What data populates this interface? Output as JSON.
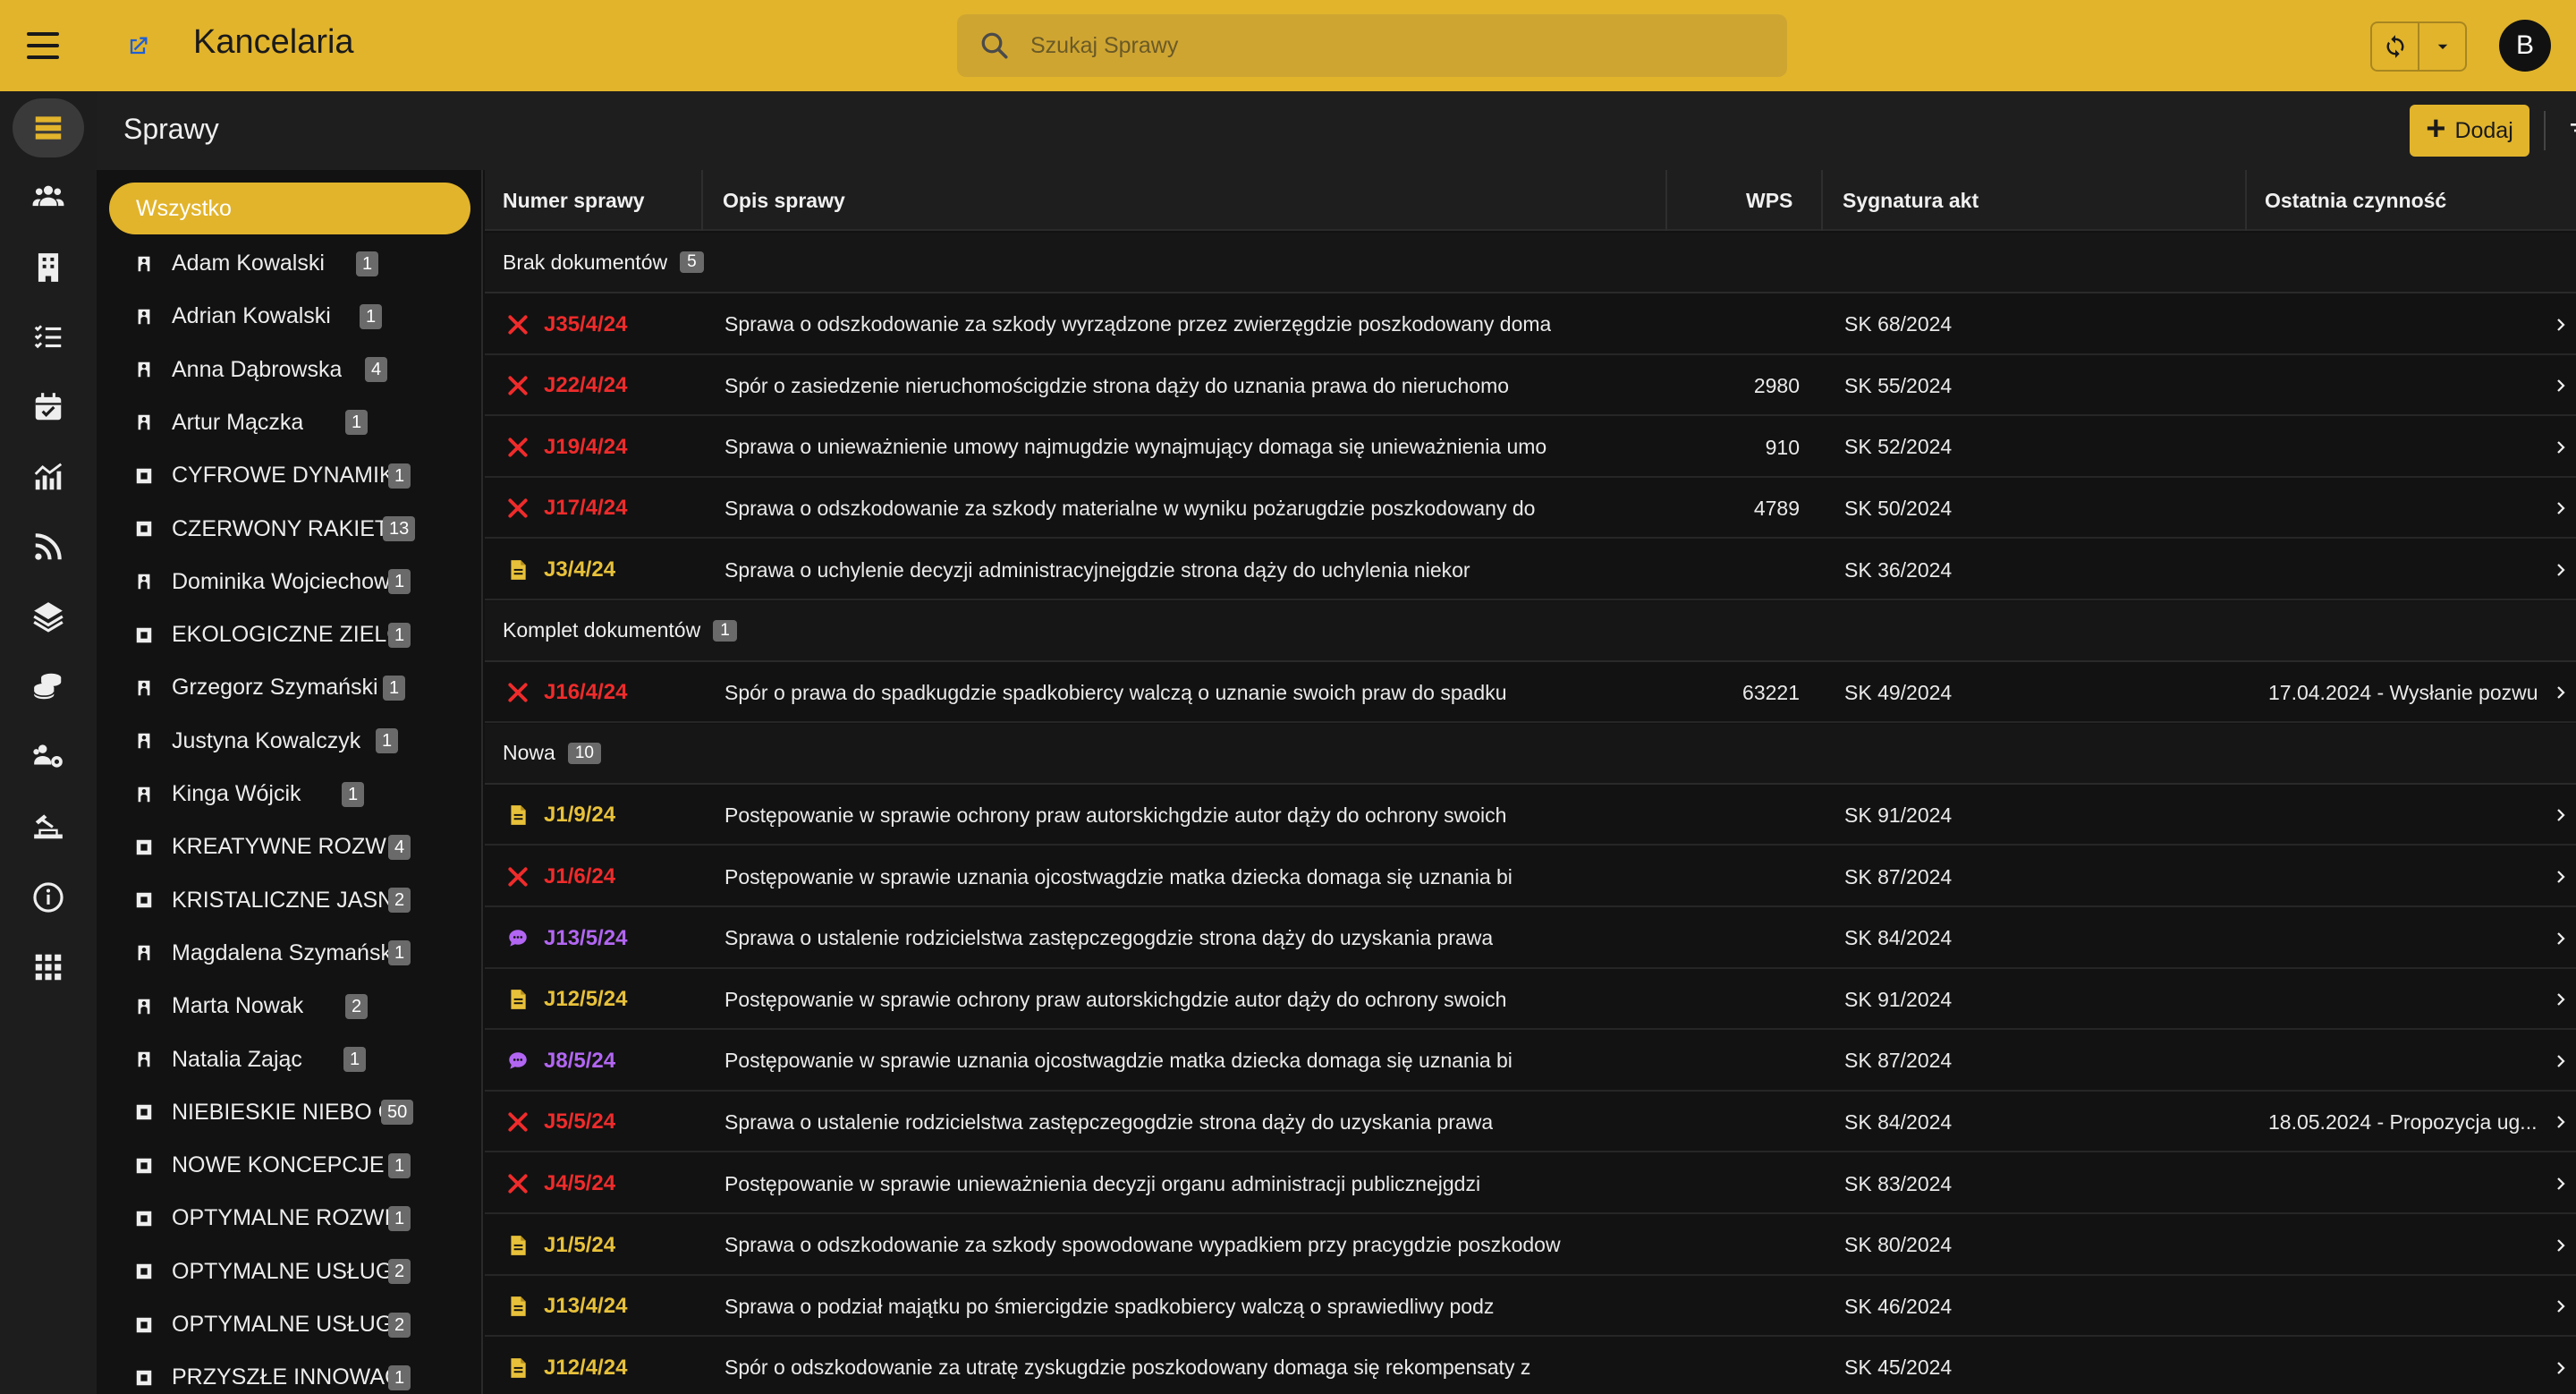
{
  "app": {
    "title": "Kancelaria",
    "search_placeholder": "Szukaj Sprawy",
    "avatar_letter": "B",
    "accent": "#e2b42c"
  },
  "page": {
    "title": "Sprawy",
    "add_label": "Dodaj"
  },
  "rail": [
    "cases-icon",
    "people-icon",
    "building-icon",
    "checklist-icon",
    "calendar-icon",
    "chart-icon",
    "rss-icon",
    "layers-icon",
    "coins-icon",
    "group-settings-icon",
    "court-icon",
    "info-icon",
    "apps-icon"
  ],
  "sidebar": {
    "all_label": "Wszystko",
    "items": [
      {
        "name": "Adam Kowalski",
        "count": "1",
        "kind": "person"
      },
      {
        "name": "Adrian Kowalski",
        "count": "1",
        "kind": "person"
      },
      {
        "name": "Anna Dąbrowska",
        "count": "4",
        "kind": "person"
      },
      {
        "name": "Artur Mączka",
        "count": "1",
        "kind": "person"
      },
      {
        "name": "CYFROWE DYNAMIKI",
        "count": "1",
        "kind": "company"
      },
      {
        "name": "CZERWONY RAKIET",
        "count": "13",
        "kind": "company"
      },
      {
        "name": "Dominika Wojciechow",
        "count": "1",
        "kind": "person"
      },
      {
        "name": "EKOLOGICZNE ZIELOI",
        "count": "1",
        "kind": "company"
      },
      {
        "name": "Grzegorz Szymański",
        "count": "1",
        "kind": "person"
      },
      {
        "name": "Justyna Kowalczyk",
        "count": "1",
        "kind": "person"
      },
      {
        "name": "Kinga Wójcik",
        "count": "1",
        "kind": "person"
      },
      {
        "name": "KREATYWNE ROZWIĄ",
        "count": "4",
        "kind": "company"
      },
      {
        "name": "KRISTALICZNE JASNI",
        "count": "2",
        "kind": "company"
      },
      {
        "name": "Magdalena Szymańsk",
        "count": "1",
        "kind": "person"
      },
      {
        "name": "Marta Nowak",
        "count": "2",
        "kind": "person"
      },
      {
        "name": "Natalia Zając",
        "count": "1",
        "kind": "person"
      },
      {
        "name": "NIEBIESKIE NIEBO G",
        "count": "50",
        "kind": "company"
      },
      {
        "name": "NOWE KONCEPCJE H",
        "count": "1",
        "kind": "company"
      },
      {
        "name": "OPTYMALNE ROZWIĄ",
        "count": "1",
        "kind": "company"
      },
      {
        "name": "OPTYMALNE USŁUGI",
        "count": "2",
        "kind": "company"
      },
      {
        "name": "OPTYMALNE USŁUGI",
        "count": "2",
        "kind": "company"
      },
      {
        "name": "PRZYSZŁE INNOWAC.",
        "count": "1",
        "kind": "company"
      }
    ]
  },
  "table": {
    "columns": [
      "Numer sprawy",
      "Opis sprawy",
      "WPS",
      "Sygnatura akt",
      "Ostatnia czynność"
    ],
    "groups": [
      {
        "label": "Brak dokumentów",
        "count": "5",
        "rows": [
          {
            "status": "error",
            "num": "J35/4/24",
            "desc": "Sprawa o odszkodowanie za szkody wyrządzone przez zwierzęgdzie poszkodowany doma",
            "wps": "",
            "sig": "SK 68/2024",
            "last": ""
          },
          {
            "status": "error",
            "num": "J22/4/24",
            "desc": "Spór o zasiedzenie nieruchomościgdzie strona dąży do uznania prawa do nieruchomo",
            "wps": "2980",
            "sig": "SK 55/2024",
            "last": ""
          },
          {
            "status": "error",
            "num": "J19/4/24",
            "desc": "Sprawa o unieważnienie umowy najmugdzie wynajmujący domaga się unieważnienia umo",
            "wps": "910",
            "sig": "SK 52/2024",
            "last": ""
          },
          {
            "status": "error",
            "num": "J17/4/24",
            "desc": "Sprawa o odszkodowanie za szkody materialne w wyniku pożarugdzie poszkodowany do",
            "wps": "4789",
            "sig": "SK 50/2024",
            "last": ""
          },
          {
            "status": "doc",
            "num": "J3/4/24",
            "desc": "Sprawa o uchylenie decyzji administracyjnejgdzie strona dąży do uchylenia niekor",
            "wps": "",
            "sig": "SK 36/2024",
            "last": ""
          }
        ]
      },
      {
        "label": "Komplet dokumentów",
        "count": "1",
        "rows": [
          {
            "status": "error",
            "num": "J16/4/24",
            "desc": "Spór o prawa do spadkugdzie spadkobiercy walczą o uznanie swoich praw do spadku",
            "wps": "63221",
            "sig": "SK 49/2024",
            "last": "17.04.2024 - Wysłanie pozwu"
          }
        ]
      },
      {
        "label": "Nowa",
        "count": "10",
        "rows": [
          {
            "status": "doc",
            "num": "J1/9/24",
            "desc": "Postępowanie w sprawie ochrony praw autorskichgdzie autor dąży do ochrony swoich",
            "wps": "",
            "sig": "SK 91/2024",
            "last": ""
          },
          {
            "status": "error",
            "num": "J1/6/24",
            "desc": "Postępowanie w sprawie uznania ojcostwagdzie matka dziecka domaga się uznania bi",
            "wps": "",
            "sig": "SK 87/2024",
            "last": ""
          },
          {
            "status": "chat",
            "num": "J13/5/24",
            "desc": "Sprawa o ustalenie rodzicielstwa zastępczegogdzie strona dąży do uzyskania prawa",
            "wps": "",
            "sig": "SK 84/2024",
            "last": ""
          },
          {
            "status": "doc",
            "num": "J12/5/24",
            "desc": "Postępowanie w sprawie ochrony praw autorskichgdzie autor dąży do ochrony swoich",
            "wps": "",
            "sig": "SK 91/2024",
            "last": ""
          },
          {
            "status": "chat",
            "num": "J8/5/24",
            "desc": "Postępowanie w sprawie uznania ojcostwagdzie matka dziecka domaga się uznania bi",
            "wps": "",
            "sig": "SK 87/2024",
            "last": ""
          },
          {
            "status": "error",
            "num": "J5/5/24",
            "desc": "Sprawa o ustalenie rodzicielstwa zastępczegogdzie strona dąży do uzyskania prawa",
            "wps": "",
            "sig": "SK 84/2024",
            "last": "18.05.2024 - Propozycja ug..."
          },
          {
            "status": "error",
            "num": "J4/5/24",
            "desc": "Postępowanie w sprawie unieważnienia decyzji organu administracji publicznejgdzi",
            "wps": "",
            "sig": "SK 83/2024",
            "last": ""
          },
          {
            "status": "doc",
            "num": "J1/5/24",
            "desc": "Sprawa o odszkodowanie za szkody spowodowane wypadkiem przy pracygdzie poszkodow",
            "wps": "",
            "sig": "SK 80/2024",
            "last": ""
          },
          {
            "status": "doc",
            "num": "J13/4/24",
            "desc": "Sprawa o podział majątku po śmiercigdzie spadkobiercy walczą o sprawiedliwy podz",
            "wps": "",
            "sig": "SK 46/2024",
            "last": ""
          },
          {
            "status": "doc",
            "num": "J12/4/24",
            "desc": "Spór o odszkodowanie za utratę zyskugdzie poszkodowany domaga się rekompensaty z",
            "wps": "",
            "sig": "SK 45/2024",
            "last": ""
          }
        ]
      }
    ]
  },
  "status_colors": {
    "error": "#ef2b2b",
    "doc": "#e8c13a",
    "chat": "#b266f2"
  }
}
